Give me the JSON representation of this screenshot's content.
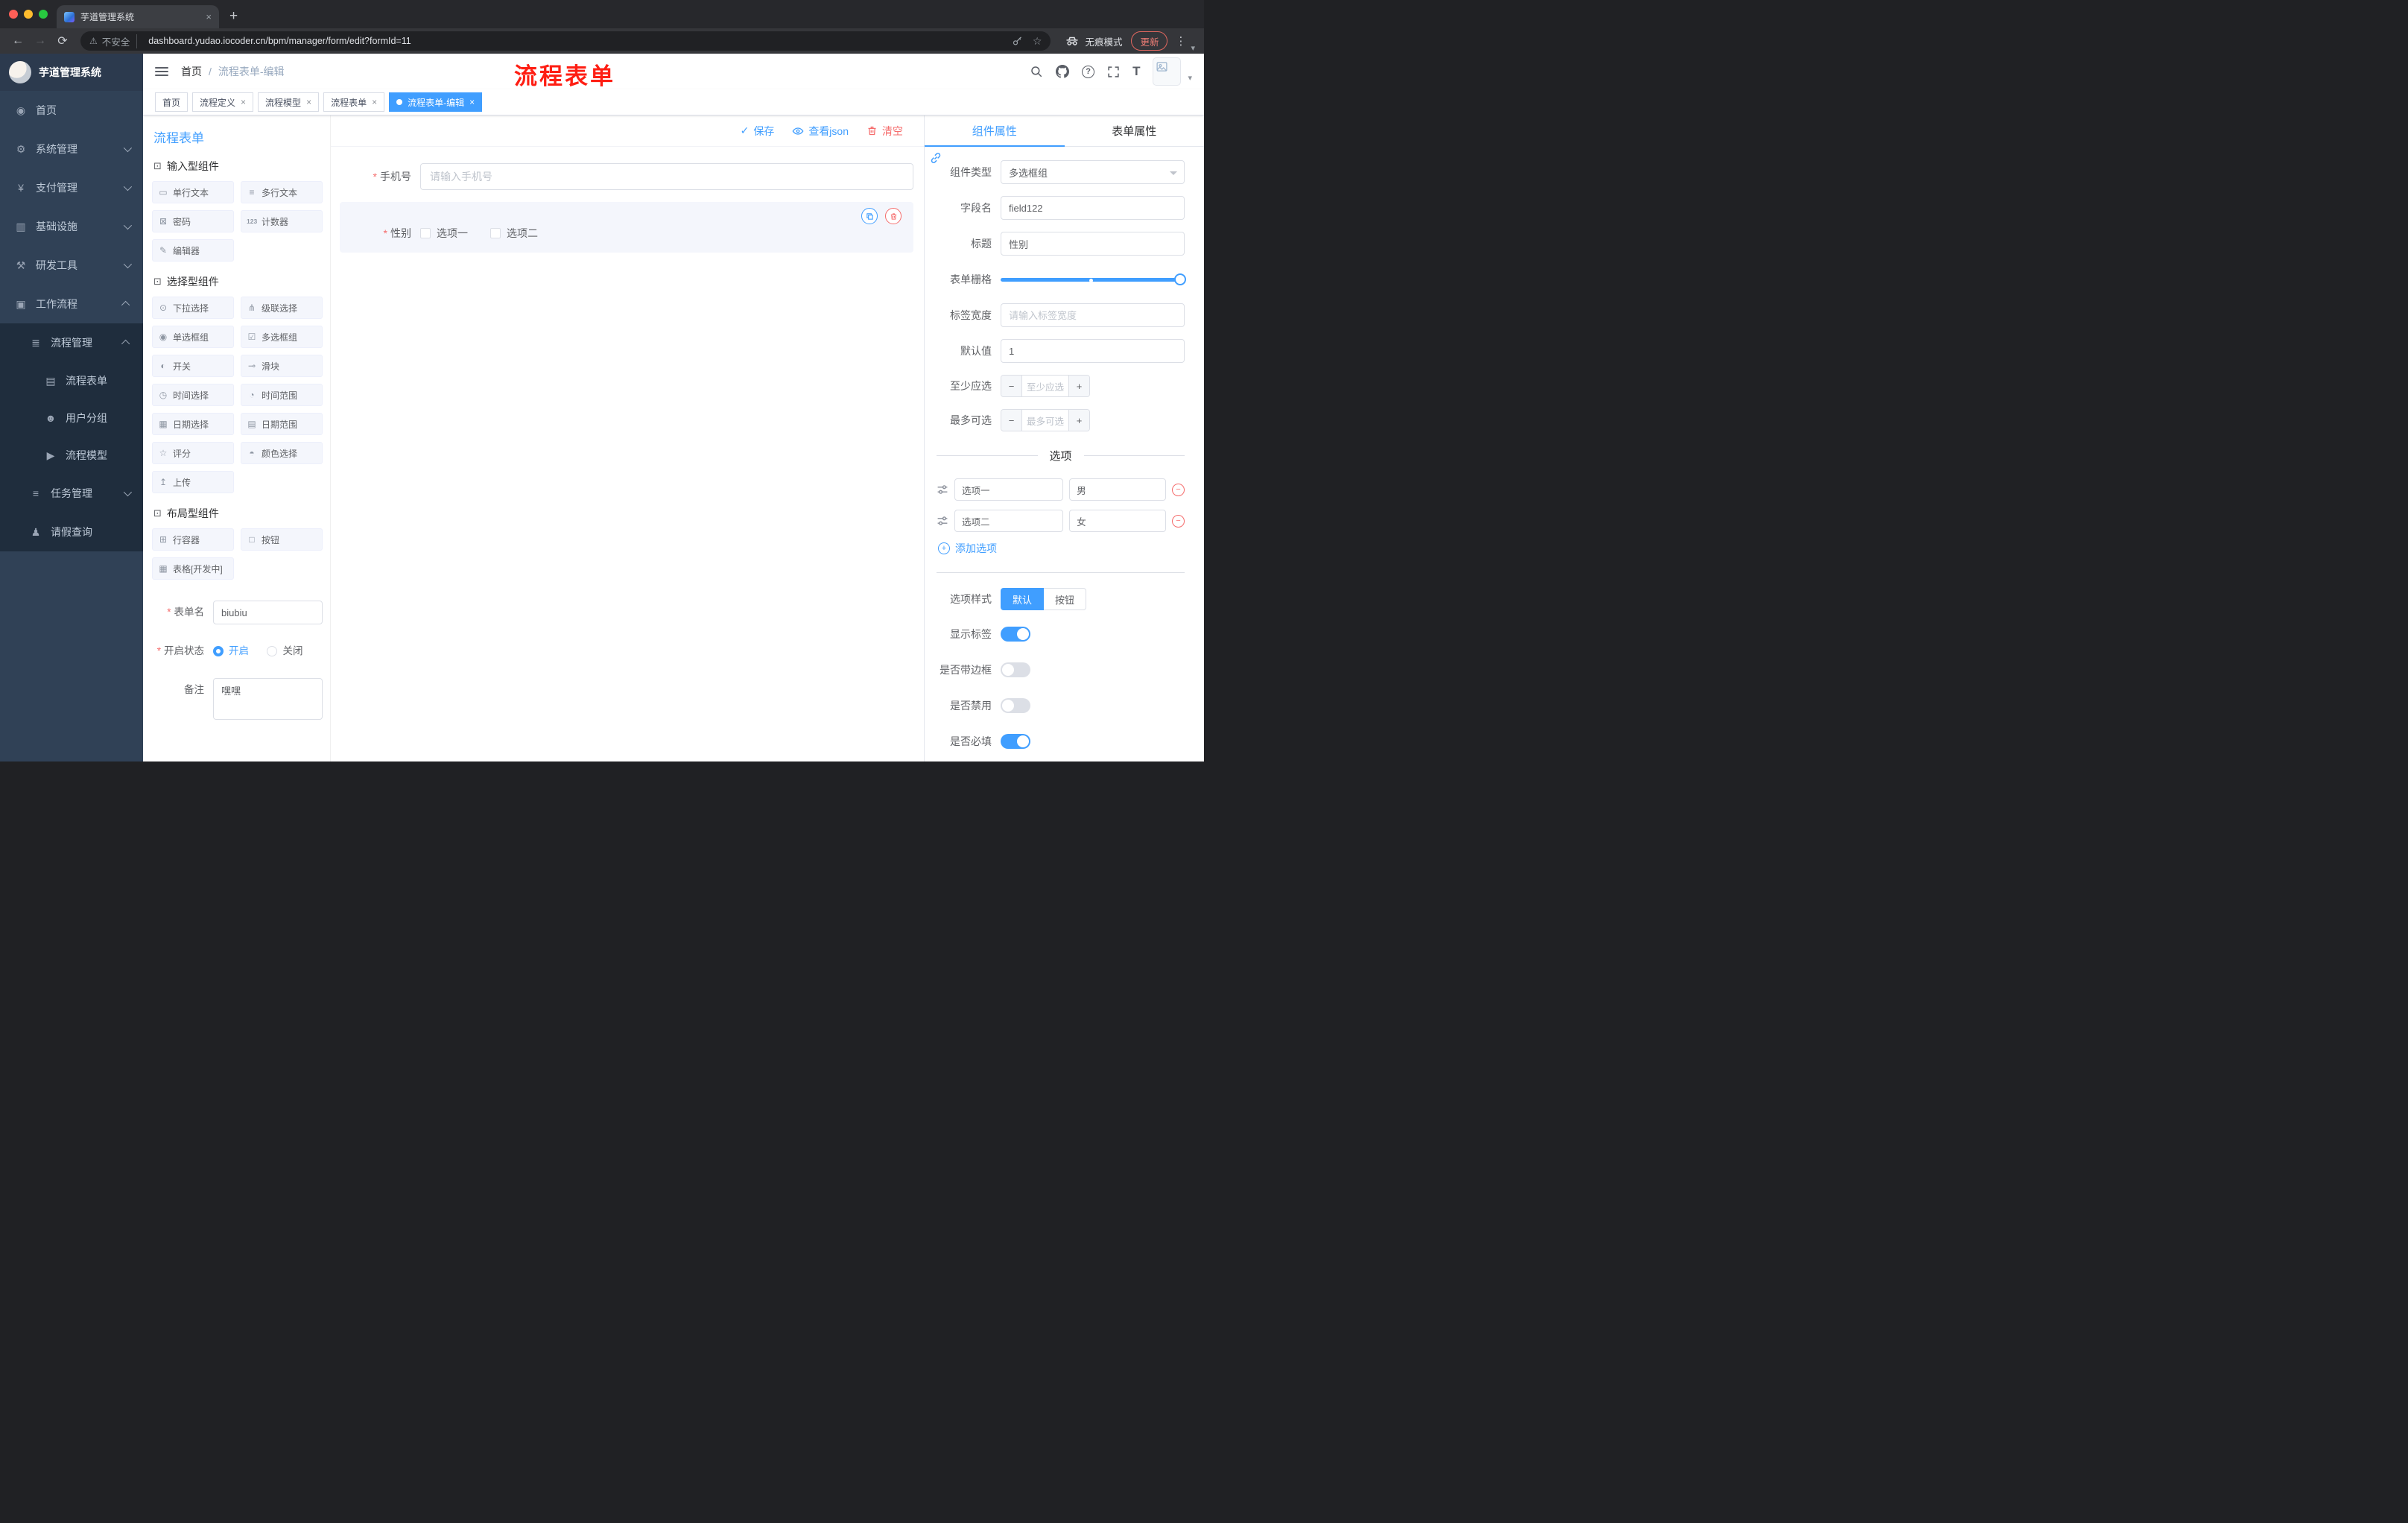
{
  "browser": {
    "tab_title": "芋道管理系统",
    "security_label": "不安全",
    "url": "dashboard.yudao.iocoder.cn/bpm/manager/form/edit?formId=11",
    "incognito_label": "无痕模式",
    "update_label": "更新"
  },
  "icons": {
    "back": "←",
    "forward": "→",
    "reload": "⟳",
    "warning": "⚠",
    "star": "☆",
    "kebab": "⋮",
    "caret_down": "▾",
    "close": "×",
    "new_tab": "+",
    "check": "✓",
    "plus": "+",
    "minus": "−",
    "question": "?",
    "font_size": "T",
    "section_cube": "⊡"
  },
  "colors": {
    "primary": "#409eff",
    "danger": "#f56c6c",
    "sidebar_bg": "#304156",
    "submenu_bg": "#1f2d3d",
    "annotation": "#fe1e13",
    "tag_active_bg": "#409eff"
  },
  "sidebar": {
    "brand": "芋道管理系统",
    "items": [
      {
        "label": "首页",
        "icon": "◉"
      },
      {
        "label": "系统管理",
        "icon": "⚙"
      },
      {
        "label": "支付管理",
        "icon": "¥"
      },
      {
        "label": "基础设施",
        "icon": "▥"
      },
      {
        "label": "研发工具",
        "icon": "⚒"
      },
      {
        "label": "工作流程",
        "icon": "▣",
        "expanded": true
      }
    ],
    "submenu": {
      "label": "流程管理",
      "icon": "≣",
      "expanded": true,
      "children": [
        {
          "label": "流程表单",
          "icon": "▤",
          "active": true
        },
        {
          "label": "用户分组",
          "icon": "☻"
        },
        {
          "label": "流程模型",
          "icon": "▶"
        }
      ]
    },
    "more_items": [
      {
        "label": "任务管理",
        "icon": "≡",
        "expanded": false
      },
      {
        "label": "请假查询",
        "icon": "♟"
      }
    ]
  },
  "header": {
    "breadcrumb": [
      "首页",
      "流程表单-编辑"
    ],
    "breadcrumb_separator": "/",
    "annotation": "流程表单"
  },
  "tags": [
    {
      "label": "首页",
      "closable": false,
      "active": false
    },
    {
      "label": "流程定义",
      "closable": true,
      "active": false
    },
    {
      "label": "流程模型",
      "closable": true,
      "active": false
    },
    {
      "label": "流程表单",
      "closable": true,
      "active": false
    },
    {
      "label": "流程表单-编辑",
      "closable": true,
      "active": true
    }
  ],
  "components": {
    "title": "流程表单",
    "sections": [
      {
        "title": "输入型组件",
        "items": [
          {
            "label": "单行文本",
            "icon": "▭"
          },
          {
            "label": "多行文本",
            "icon": "≡"
          },
          {
            "label": "密码",
            "icon": "⊠"
          },
          {
            "label": "计数器",
            "icon": "123"
          },
          {
            "label": "编辑器",
            "icon": "✎"
          }
        ]
      },
      {
        "title": "选择型组件",
        "items": [
          {
            "label": "下拉选择",
            "icon": "⊙"
          },
          {
            "label": "级联选择",
            "icon": "⋔"
          },
          {
            "label": "单选框组",
            "icon": "◉"
          },
          {
            "label": "多选框组",
            "icon": "☑"
          },
          {
            "label": "开关",
            "icon": "◐"
          },
          {
            "label": "滑块",
            "icon": "⊸"
          },
          {
            "label": "时间选择",
            "icon": "◷"
          },
          {
            "label": "时间范围",
            "icon": "◔"
          },
          {
            "label": "日期选择",
            "icon": "▦"
          },
          {
            "label": "日期范围",
            "icon": "▤"
          },
          {
            "label": "评分",
            "icon": "☆"
          },
          {
            "label": "颜色选择",
            "icon": "◓"
          },
          {
            "label": "上传",
            "icon": "↥"
          }
        ]
      },
      {
        "title": "布局型组件",
        "items": [
          {
            "label": "行容器",
            "icon": "⊞"
          },
          {
            "label": "按钮",
            "icon": "□"
          },
          {
            "label": "表格[开发中]",
            "icon": "▦"
          }
        ]
      }
    ],
    "form": {
      "name_label": "表单名",
      "name_value": "biubiu",
      "status_label": "开启状态",
      "status_on": "开启",
      "status_off": "关闭",
      "status_selected": "开启",
      "remark_label": "备注",
      "remark_value": "嘿嘿"
    }
  },
  "canvas": {
    "actions": {
      "save": "保存",
      "view_json": "查看json",
      "clear": "清空"
    },
    "phone": {
      "label": "手机号",
      "placeholder": "请输入手机号",
      "required": true
    },
    "gender": {
      "label": "性别",
      "required": true,
      "options": [
        "选项一",
        "选项二"
      ],
      "selected_widget": true
    }
  },
  "props": {
    "tabs": [
      "组件属性",
      "表单属性"
    ],
    "active_tab": "组件属性",
    "component_type": {
      "label": "组件类型",
      "value": "多选框组"
    },
    "field_name": {
      "label": "字段名",
      "value": "field122"
    },
    "title": {
      "label": "标题",
      "value": "性别"
    },
    "grid": {
      "label": "表单栅格",
      "value": 24,
      "max": 24
    },
    "label_width": {
      "label": "标签宽度",
      "placeholder": "请输入标签宽度"
    },
    "default_value": {
      "label": "默认值",
      "value": "1"
    },
    "min_select": {
      "label": "至少应选",
      "placeholder": "至少应选"
    },
    "max_select": {
      "label": "最多可选",
      "placeholder": "最多可选"
    },
    "options_title": "选项",
    "options": [
      {
        "label": "选项一",
        "value": "男"
      },
      {
        "label": "选项二",
        "value": "女"
      }
    ],
    "add_option": "添加选项",
    "option_style": {
      "label": "选项样式",
      "choices": [
        "默认",
        "按钮"
      ],
      "selected": "默认"
    },
    "switches": [
      {
        "label": "显示标签",
        "on": true
      },
      {
        "label": "是否带边框",
        "on": false
      },
      {
        "label": "是否禁用",
        "on": false
      },
      {
        "label": "是否必填",
        "on": true
      }
    ]
  }
}
